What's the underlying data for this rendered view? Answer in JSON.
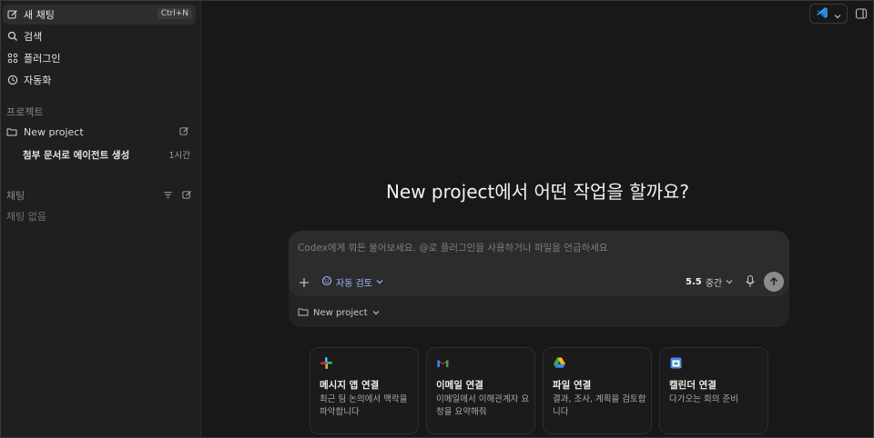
{
  "sidebar": {
    "nav": [
      {
        "label": "새 채팅",
        "shortcut": "Ctrl+N",
        "icon": "edit-icon"
      },
      {
        "label": "검색",
        "icon": "search-icon"
      },
      {
        "label": "플러그인",
        "icon": "grid-icon"
      },
      {
        "label": "자동화",
        "icon": "clock-icon"
      }
    ],
    "projects_label": "프로젝트",
    "project": {
      "name": "New project"
    },
    "thread": {
      "title": "첨부 문서로 에이전트 생성",
      "time": "1시간"
    },
    "chats_label": "채팅",
    "chats_empty": "채팅 없음"
  },
  "main": {
    "title": "New project에서 어떤 작업을 할까요?",
    "composer": {
      "placeholder": "Codex에게 뭐든 물어보세요. @로 플러그인을 사용하거나 파일을 언급하세요",
      "review_label": "자동 검토",
      "model_version": "5.5",
      "model_effort": "중간",
      "project_selector": "New project"
    },
    "cards": [
      {
        "title": "메시지 앱 연결",
        "desc": "최근 팀 논의에서 맥락을 파악합니다",
        "icon": "slack-icon"
      },
      {
        "title": "이메일 연결",
        "desc": "이메일에서 이해관계자 요청을 요약해줘",
        "icon": "gmail-icon"
      },
      {
        "title": "파일 연결",
        "desc": "결과, 조사, 계획을 검토합니다",
        "icon": "google-drive-icon"
      },
      {
        "title": "캘린더 연결",
        "desc": "다가오는 회의 준비",
        "icon": "calendar-icon"
      }
    ]
  },
  "colors": {
    "background": "#181818",
    "sidebar": "#1f1f1f",
    "accent": "#9bb7ff"
  }
}
